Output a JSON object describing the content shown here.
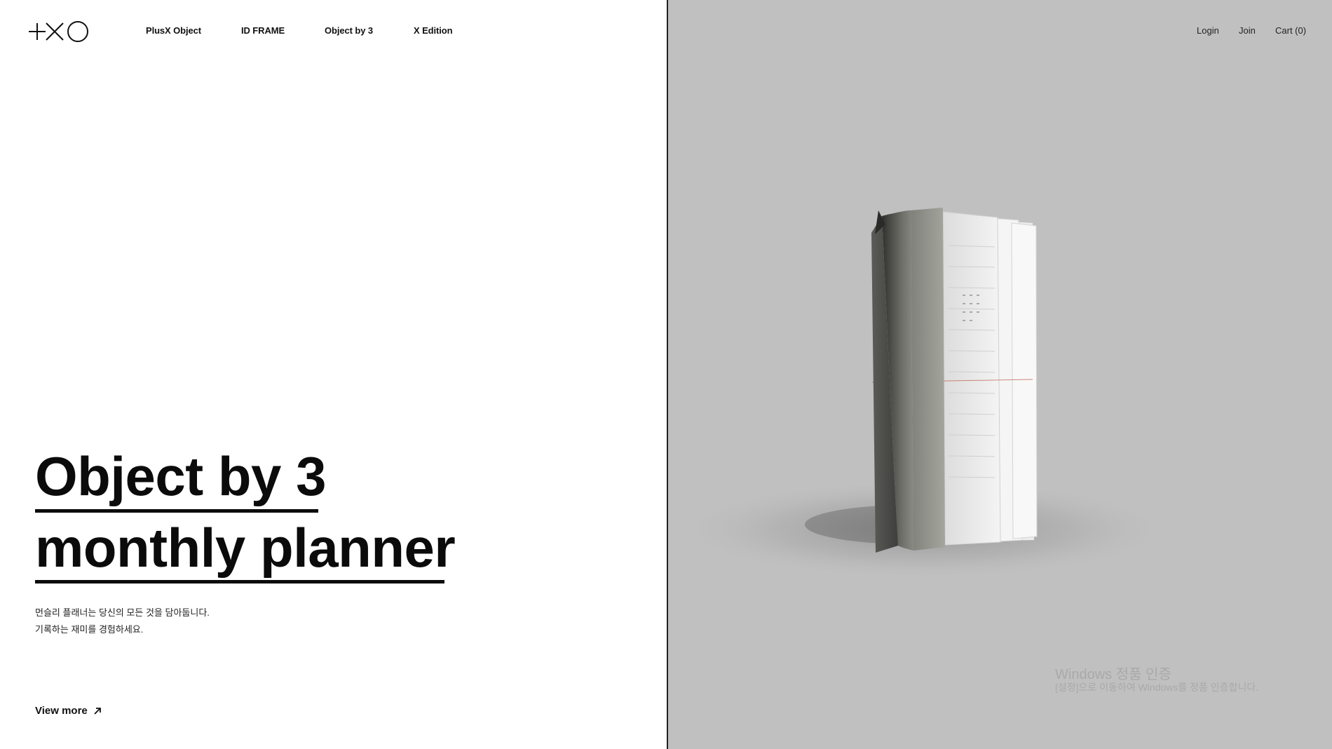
{
  "brand": {
    "logo_icon": "plusx-object-logo"
  },
  "nav": {
    "items": [
      {
        "label": "PlusX Object"
      },
      {
        "label": "ID FRAME"
      },
      {
        "label": "Object by 3"
      },
      {
        "label": "X Edition"
      }
    ]
  },
  "utility": {
    "login": "Login",
    "join": "Join",
    "cart": "Cart (0)"
  },
  "hero": {
    "title_line1": "Object by 3",
    "title_line2": "monthly planner",
    "description_line1": "먼슬리 플래너는 당신의 모든 것을 담아둡니다.",
    "description_line2": "기록하는 재미를 경험하세요.",
    "view_more_label": "View more",
    "view_more_icon": "arrow-up-right-icon"
  },
  "product_image": {
    "subject": "planner-image"
  },
  "windows_watermark": {
    "title": "Windows 정품 인증",
    "subtitle": "[설정]으로 이동하여 Windows를 정품 인증합니다."
  },
  "colors": {
    "text": "#111111",
    "right_panel_bg": "#c0c0c0",
    "divider": "#222222"
  }
}
